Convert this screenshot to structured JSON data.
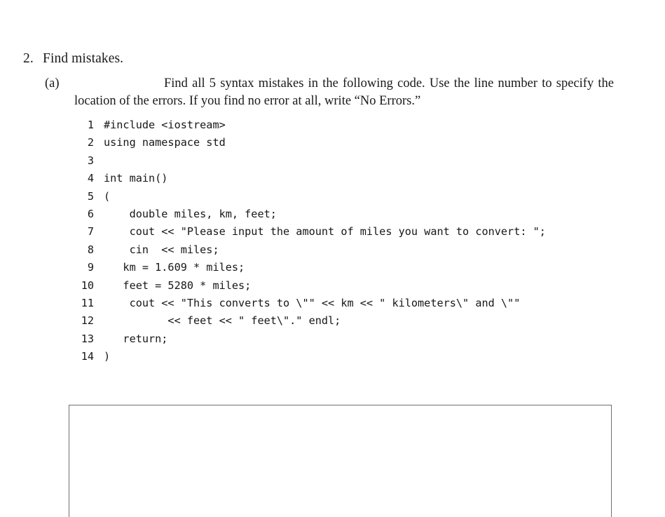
{
  "question": {
    "number": "2.",
    "title": "Find mistakes."
  },
  "part_a": {
    "label": "(a)",
    "text": "Find all 5 syntax mistakes in the following code. Use the line number to specify the location of the errors. If you find no error at all, write “No Errors.”"
  },
  "code": {
    "lines": [
      {
        "number": "1",
        "text": "#include <iostream>"
      },
      {
        "number": "2",
        "text": "using namespace std"
      },
      {
        "number": "3",
        "text": ""
      },
      {
        "number": "4",
        "text": "int main()"
      },
      {
        "number": "5",
        "text": "("
      },
      {
        "number": "6",
        "text": "    double miles, km, feet;"
      },
      {
        "number": "7",
        "text": "    cout << \"Please input the amount of miles you want to convert: \";"
      },
      {
        "number": "8",
        "text": "    cin  << miles;"
      },
      {
        "number": "9",
        "text": "   km = 1.609 * miles;"
      },
      {
        "number": "10",
        "text": "   feet = 5280 * miles;"
      },
      {
        "number": "11",
        "text": "    cout << \"This converts to \\\"\" << km << \" kilometers\\\" and \\\"\""
      },
      {
        "number": "12",
        "text": "          << feet << \" feet\\\".\" endl;"
      },
      {
        "number": "13",
        "text": "   return;"
      },
      {
        "number": "14",
        "text": ")"
      }
    ]
  },
  "answer_area": {
    "value": "",
    "placeholder": ""
  }
}
